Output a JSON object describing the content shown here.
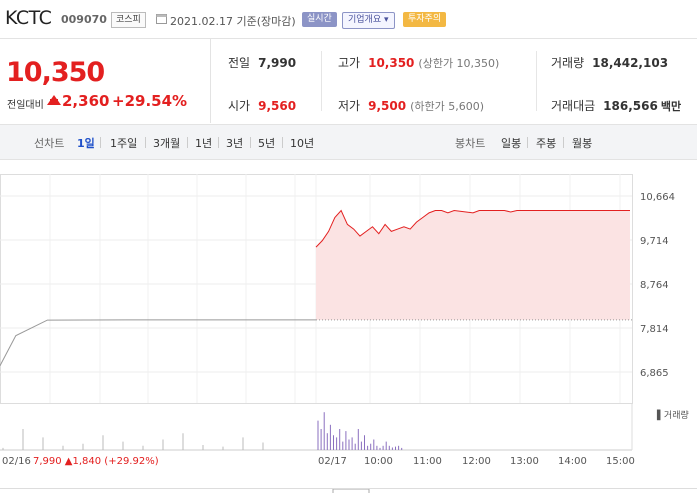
{
  "header": {
    "stock_name": "KCTC",
    "stock_code": "009070",
    "market": "코스피",
    "date_text": "2021.02.17 기준(장마감)",
    "btn_live": "실시간",
    "btn_info": "기업개요 ▾",
    "btn_warn": "투자주의"
  },
  "price": {
    "current": "10,350",
    "change_label": "전일대비",
    "change": "2,360",
    "change_pct": "+29.54%"
  },
  "stats": {
    "prev_close_label": "전일",
    "prev_close": "7,990",
    "high_label": "고가",
    "high": "10,350",
    "upper_limit": "(상한가 10,350)",
    "volume_label": "거래량",
    "volume": "18,442,103",
    "open_label": "시가",
    "open": "9,560",
    "low_label": "저가",
    "low": "9,500",
    "lower_limit": "(하한가 5,600)",
    "amount_label": "거래대금",
    "amount": "186,566",
    "amount_unit": "백만"
  },
  "tabs": {
    "line_label": "선차트",
    "line_periods": [
      "1일",
      "1주일",
      "3개월",
      "1년",
      "3년",
      "5년",
      "10년"
    ],
    "active_period": "1일",
    "candle_label": "봉차트",
    "candle_periods": [
      "일봉",
      "주봉",
      "월봉"
    ]
  },
  "colors": {
    "up": "#e32020",
    "down": "#1f50c9",
    "accent": "#8c94c6",
    "warn": "#f3b843"
  },
  "chart_data": {
    "type": "line",
    "price_axis_ticks": [
      "10,664",
      "9,714",
      "8,764",
      "7,814",
      "6,865"
    ],
    "ylim": [
      6865,
      10664
    ],
    "time_axis_ticks": [
      "02/17",
      "10:00",
      "11:00",
      "12:00",
      "13:00",
      "14:00",
      "15:00"
    ],
    "prev_day_label": "02/16",
    "prev_day_summary": {
      "close": "7,990",
      "change": "1,840",
      "pct": "(+29.92%)"
    },
    "volume_legend": "거래량",
    "prev_close_ref": 7990,
    "prev_day_series": [
      [
        0,
        7000
      ],
      [
        0.05,
        7650
      ],
      [
        0.15,
        7985
      ],
      [
        0.4,
        7990
      ],
      [
        1,
        7990
      ]
    ],
    "today_series": [
      [
        0,
        9560
      ],
      [
        0.02,
        9700
      ],
      [
        0.04,
        9900
      ],
      [
        0.06,
        10200
      ],
      [
        0.08,
        10350
      ],
      [
        0.1,
        10050
      ],
      [
        0.12,
        9950
      ],
      [
        0.14,
        9800
      ],
      [
        0.16,
        9900
      ],
      [
        0.18,
        10000
      ],
      [
        0.2,
        9850
      ],
      [
        0.22,
        10050
      ],
      [
        0.24,
        9900
      ],
      [
        0.26,
        9950
      ],
      [
        0.28,
        10000
      ],
      [
        0.3,
        9950
      ],
      [
        0.32,
        10100
      ],
      [
        0.34,
        10200
      ],
      [
        0.36,
        10300
      ],
      [
        0.38,
        10350
      ],
      [
        0.4,
        10350
      ],
      [
        0.42,
        10300
      ],
      [
        0.44,
        10350
      ],
      [
        0.5,
        10300
      ],
      [
        0.52,
        10350
      ],
      [
        0.6,
        10350
      ],
      [
        0.62,
        10320
      ],
      [
        0.64,
        10350
      ],
      [
        0.7,
        10350
      ],
      [
        0.8,
        10350
      ],
      [
        0.9,
        10350
      ],
      [
        1,
        10350
      ]
    ],
    "volume_prev": [
      0.05,
      0.5,
      0.3,
      0.1,
      0.15,
      0.35,
      0.2,
      0.1,
      0.25,
      0.4,
      0.12,
      0.08,
      0.3,
      0.18
    ],
    "volume_today": [
      0.7,
      0.5,
      0.9,
      0.4,
      0.6,
      0.35,
      0.3,
      0.5,
      0.2,
      0.45,
      0.25,
      0.3,
      0.15,
      0.5,
      0.2,
      0.35,
      0.1,
      0.15,
      0.25,
      0.1,
      0.05,
      0.1,
      0.2,
      0.1,
      0.06,
      0.08,
      0.1,
      0.05
    ]
  }
}
